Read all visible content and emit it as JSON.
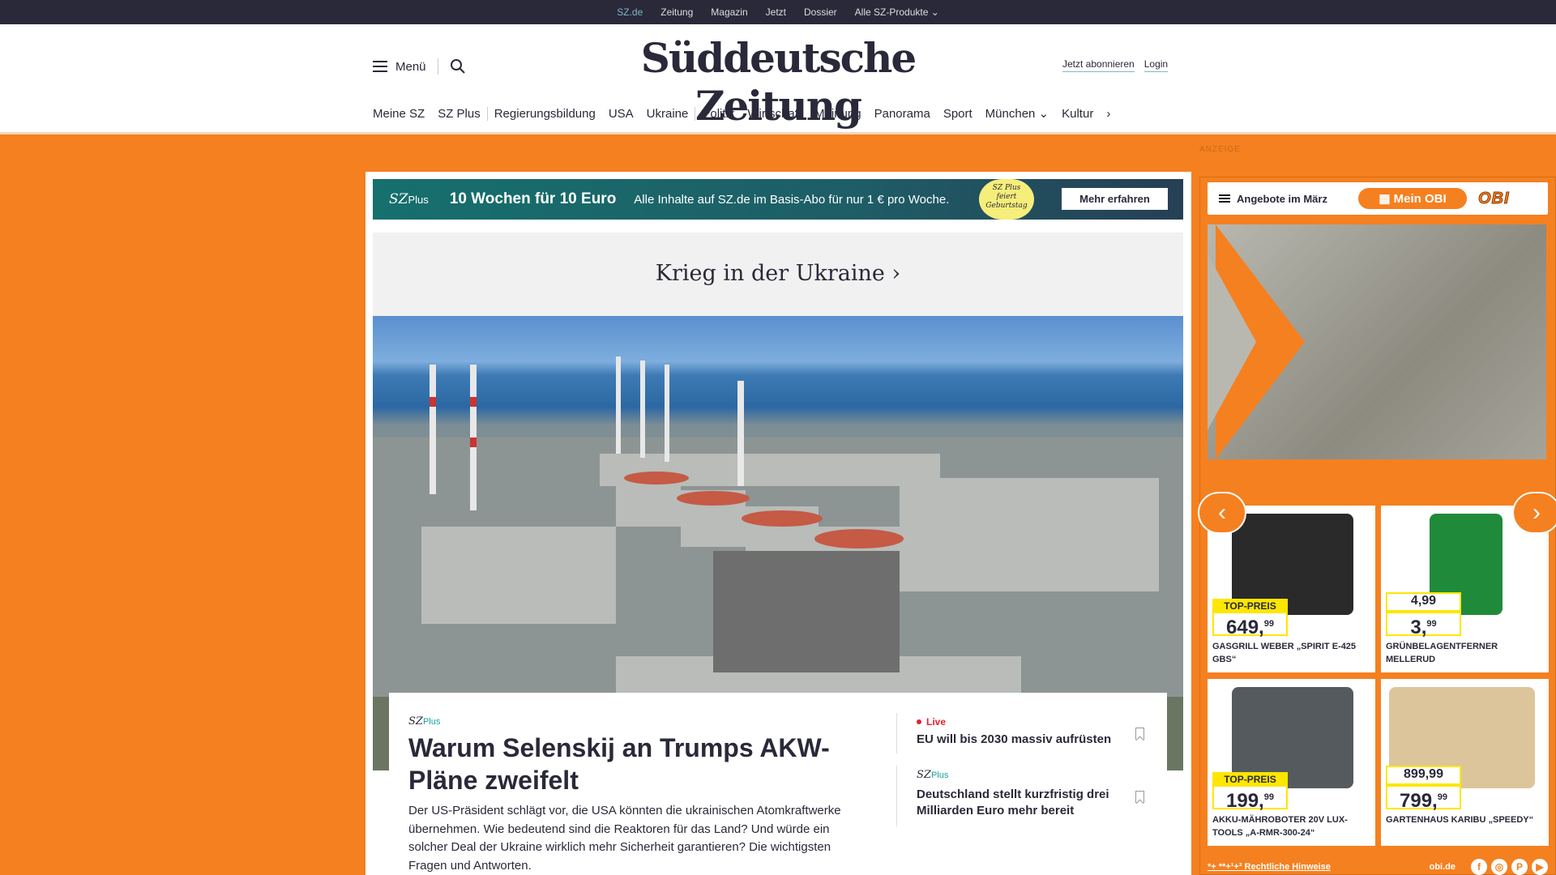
{
  "topbar": {
    "items": [
      "SZ.de",
      "Zeitung",
      "Magazin",
      "Jetzt",
      "Dossier",
      "Alle SZ-Produkte ⌄"
    ]
  },
  "header": {
    "menu": "Menü",
    "logo": "Süddeutsche Zeitung",
    "subscribe": "Jetzt abonnieren",
    "login": "Login"
  },
  "nav": [
    "Meine SZ",
    "SZ Plus",
    "Regierungsbildung",
    "USA",
    "Ukraine",
    "Politik",
    "Wirtschaft",
    "Meinung",
    "Panorama",
    "Sport",
    "München ⌄",
    "Kultur",
    "›"
  ],
  "promo": {
    "brand": "SZ",
    "brand_plus": "Plus",
    "headline": "10 Wochen für 10 Euro",
    "text": "Alle Inhalte auf SZ.de im Basis-Abo für nur 1 € pro Woche.",
    "badge_brand": "SZ Plus",
    "badge_text": "feiert Geburtstag",
    "button": "Mehr erfahren"
  },
  "section": {
    "title": "Krieg in der Ukraine ›"
  },
  "lead": {
    "brand": "SZ",
    "brand_plus": "Plus",
    "headline": "Warum Selenskij an Trumps AKW-Pläne zweifelt",
    "body": "Der US-Präsident schlägt vor, die USA könnten die ukrainischen Atomkraftwerke übernehmen. Wie bedeutend sind die Reaktoren für das Land? Und würde ein solcher Deal der Ukraine wirklich mehr Sicherheit garantieren? Die wichtigsten Fragen und Antworten."
  },
  "side": [
    {
      "label": "Live",
      "title": "EU will bis 2030 massiv aufrüsten"
    },
    {
      "brand": "SZ",
      "brand_plus": "Plus",
      "title": "Deutschland stellt kurzfristig drei Milliarden Euro mehr bereit"
    }
  ],
  "ad": {
    "label": "ANZEIGE",
    "menu": "Angebote im März",
    "mein": "Mein OBI",
    "logo": "OBI",
    "accent": "#f58020",
    "products": [
      {
        "tag": "TOP-PREIS",
        "price": "649,",
        "cents": "99",
        "name": "Gasgrill Weber „Spirit E-425 GBS“",
        "color": "#2a2a2a"
      },
      {
        "old": "4,99",
        "price": "3,",
        "cents": "99",
        "name": "Grünbelagentferner Mellerud",
        "color": "#1f8a3a"
      },
      {
        "tag": "TOP-PREIS",
        "price": "199,",
        "cents": "99",
        "name": "Akku-Mähroboter 20V Lux-Tools „A-RMR-300-24“",
        "color": "#555a5e"
      },
      {
        "old": "899,99",
        "price": "799,",
        "cents": "99",
        "name": "Gartenhaus Karibu „Speedy“",
        "color": "#dcc59a"
      }
    ],
    "footer": "*+ **+¹+² Rechtliche Hinweise",
    "site": "obi.de",
    "social": [
      "f",
      "◎",
      "P",
      "▶"
    ]
  }
}
